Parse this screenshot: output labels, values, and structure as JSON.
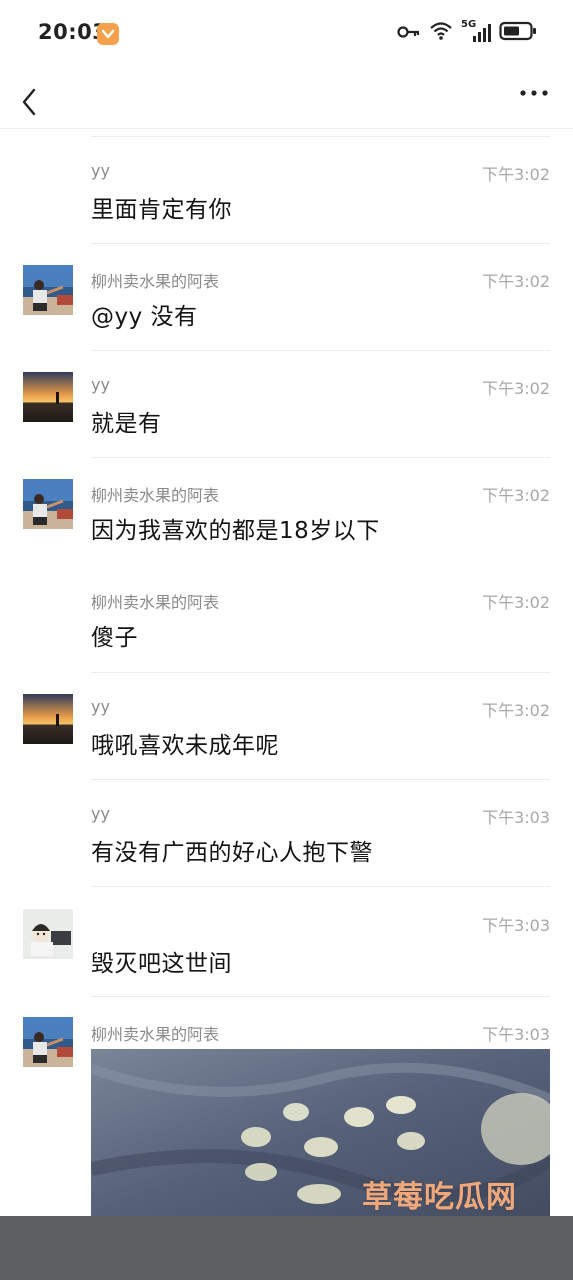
{
  "status_bar": {
    "time": "20:03",
    "network": "5G"
  },
  "nav": {
    "back_icon": "chevron-left-icon",
    "more_icon": "more-horizontal-icon"
  },
  "messages": [
    {
      "sender": "yy",
      "time": "下午3:02",
      "text": "里面肯定有你",
      "avatar": "none"
    },
    {
      "sender": "柳州卖水果的阿表",
      "time": "下午3:02",
      "text": "@yy 没有",
      "avatar": "man-by-sea"
    },
    {
      "sender": "yy",
      "time": "下午3:02",
      "text": "就是有",
      "avatar": "sunset"
    },
    {
      "sender": "柳州卖水果的阿表",
      "time": "下午3:02",
      "text": "因为我喜欢的都是18岁以下",
      "avatar": "man-by-sea"
    },
    {
      "sender": "柳州卖水果的阿表",
      "time": "下午3:02",
      "text": "傻子",
      "avatar": "none"
    },
    {
      "sender": "yy",
      "time": "下午3:02",
      "text": "哦吼喜欢未成年呢",
      "avatar": "sunset"
    },
    {
      "sender": "yy",
      "time": "下午3:03",
      "text": "有没有广西的好心人抱下警",
      "avatar": "none"
    },
    {
      "sender": "",
      "time": "下午3:03",
      "text": "毁灭吧这世间",
      "avatar": "cartoon-person"
    },
    {
      "sender": "柳州卖水果的阿表",
      "time": "下午3:03",
      "text": "",
      "avatar": "man-by-sea",
      "has_image": true
    }
  ],
  "watermark": "草莓吃瓜网",
  "colors": {
    "sender": "#8a8a8a",
    "time": "#a8a8a8",
    "text": "#141414",
    "divider": "#ececec",
    "watermark": "#f0a77a",
    "bottom_bar": "#5d5f63"
  }
}
